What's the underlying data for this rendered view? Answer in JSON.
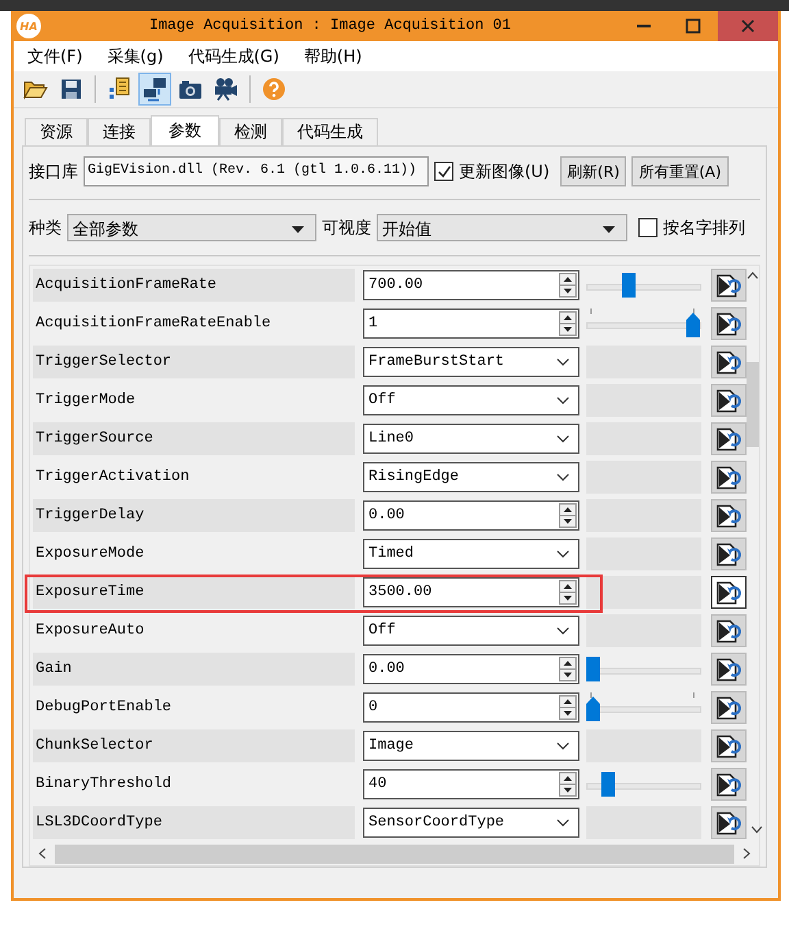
{
  "window": {
    "title": "Image Acquisition : Image Acquisition 01",
    "logo": "HA"
  },
  "menu": [
    "文件(F)",
    "采集(g)",
    "代码生成(G)",
    "帮助(H)"
  ],
  "toolbar": [
    {
      "kind": "open",
      "selected": false
    },
    {
      "kind": "save",
      "selected": false
    },
    {
      "kind": "sep"
    },
    {
      "kind": "list",
      "selected": false
    },
    {
      "kind": "connect",
      "selected": true
    },
    {
      "kind": "camera",
      "selected": false
    },
    {
      "kind": "video",
      "selected": false
    },
    {
      "kind": "sep"
    },
    {
      "kind": "help",
      "selected": false
    }
  ],
  "tabs": [
    {
      "label": "资源",
      "selected": false
    },
    {
      "label": "连接",
      "selected": false
    },
    {
      "label": "参数",
      "selected": true
    },
    {
      "label": "检测",
      "selected": false
    },
    {
      "label": "代码生成",
      "selected": false
    }
  ],
  "interface": {
    "label": "接口库",
    "value": "GigEVision.dll (Rev. 6.1 (gtl 1.0.6.11))",
    "update": {
      "label": "更新图像(U)",
      "checked": true
    },
    "buttons": [
      "刷新(R)",
      "所有重置(A)"
    ]
  },
  "filter": {
    "category_label": "种类",
    "category": "全部参数",
    "visibility_label": "可视度",
    "visibility": "开始值",
    "sort": {
      "label": "按名字排列",
      "checked": false
    }
  },
  "params": [
    {
      "name": "AcquisitionFrameRate",
      "kind": "spin",
      "value": "700.00",
      "slider": {
        "level": 0.35,
        "ticks": false
      },
      "highlighted": false
    },
    {
      "name": "AcquisitionFrameRateEnable",
      "kind": "spin",
      "value": "1",
      "slider": {
        "level": 1,
        "ticks": true
      },
      "highlighted": false
    },
    {
      "name": "TriggerSelector",
      "kind": "combo",
      "value": "FrameBurstStart",
      "highlighted": false
    },
    {
      "name": "TriggerMode",
      "kind": "combo",
      "value": "Off",
      "highlighted": false
    },
    {
      "name": "TriggerSource",
      "kind": "combo",
      "value": "Line0",
      "highlighted": false
    },
    {
      "name": "TriggerActivation",
      "kind": "combo",
      "value": "RisingEdge",
      "highlighted": false
    },
    {
      "name": "TriggerDelay",
      "kind": "spin",
      "value": "0.00",
      "highlighted": false
    },
    {
      "name": "ExposureMode",
      "kind": "combo",
      "value": "Timed",
      "highlighted": false
    },
    {
      "name": "ExposureTime",
      "kind": "spin",
      "value": "3500.00",
      "highlighted": true
    },
    {
      "name": "ExposureAuto",
      "kind": "combo",
      "value": "Off",
      "highlighted": false
    },
    {
      "name": "Gain",
      "kind": "spin",
      "value": "0.00",
      "slider": {
        "level": 0,
        "ticks": false
      },
      "highlighted": false
    },
    {
      "name": "DebugPortEnable",
      "kind": "spin",
      "value": "0",
      "slider": {
        "level": 0,
        "ticks": true
      },
      "highlighted": false
    },
    {
      "name": "ChunkSelector",
      "kind": "combo",
      "value": "Image",
      "highlighted": false
    },
    {
      "name": "BinaryThreshold",
      "kind": "spin",
      "value": "40",
      "slider": {
        "level": 0.15,
        "ticks": false
      },
      "highlighted": false
    },
    {
      "name": "LSL3DCoordType",
      "kind": "combo",
      "value": "SensorCoordType",
      "highlighted": false
    }
  ]
}
